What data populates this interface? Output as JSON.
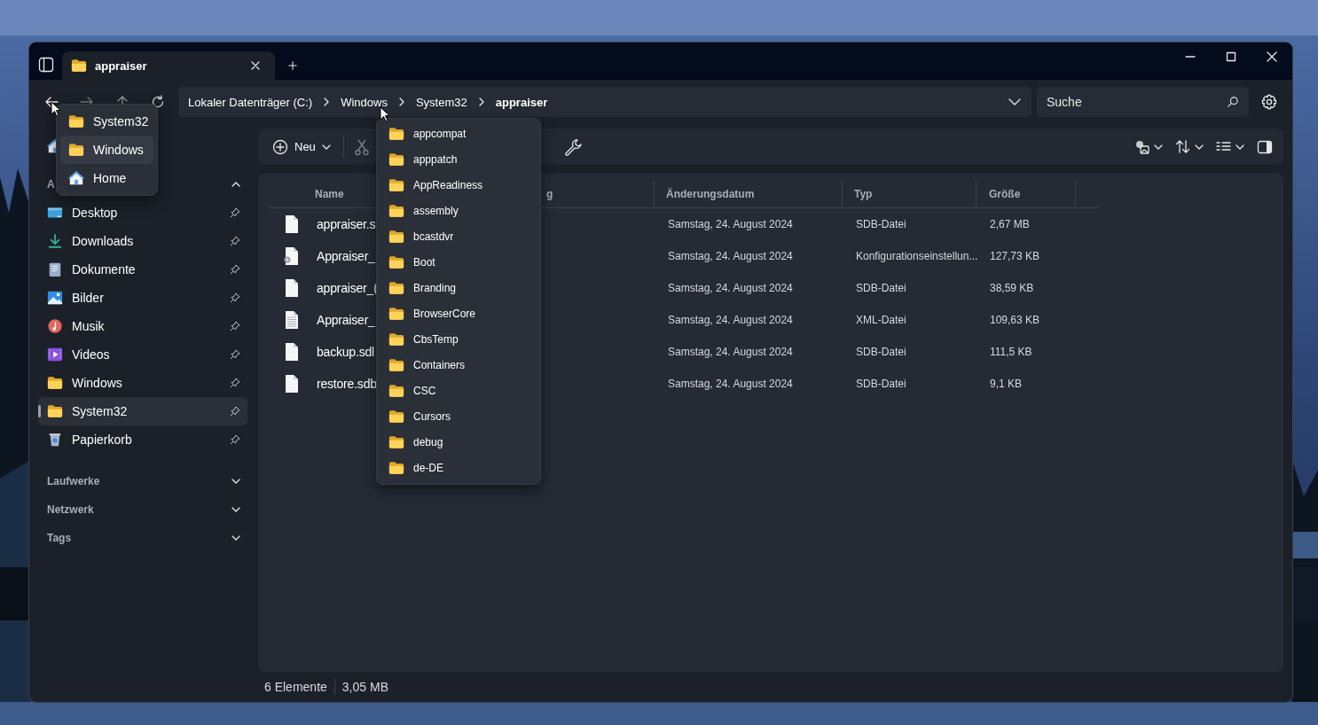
{
  "window": {
    "tab": {
      "title": "appraiser",
      "selected": true
    }
  },
  "address_bar": {
    "crumbs": [
      {
        "label": "Lokaler Datenträger (C:)",
        "current": false
      },
      {
        "label": "Windows",
        "current": false
      },
      {
        "label": "System32",
        "current": false
      },
      {
        "label": "appraiser",
        "current": true
      }
    ]
  },
  "search": {
    "placeholder": "Suche"
  },
  "history_menu": {
    "items": [
      {
        "label": "System32",
        "kind": "folder",
        "selected": false
      },
      {
        "label": "Windows",
        "kind": "folder",
        "selected": true
      },
      {
        "label": "Home",
        "kind": "home",
        "selected": false
      }
    ]
  },
  "folder_menu": {
    "items": [
      "appcompat",
      "apppatch",
      "AppReadiness",
      "assembly",
      "bcastdvr",
      "Boot",
      "Branding",
      "BrowserCore",
      "CbsTemp",
      "Containers",
      "CSC",
      "Cursors",
      "debug",
      "de-DE"
    ]
  },
  "toolbar": {
    "new_button": "Neu"
  },
  "sidebar": {
    "pinned_header": {
      "label": "A",
      "expanded": true
    },
    "items": [
      {
        "label": "Desktop",
        "kind": "desktop",
        "pinned": true,
        "selected": false
      },
      {
        "label": "Downloads",
        "kind": "download",
        "pinned": true,
        "selected": false
      },
      {
        "label": "Dokumente",
        "kind": "documents",
        "pinned": true,
        "selected": false
      },
      {
        "label": "Bilder",
        "kind": "pictures",
        "pinned": true,
        "selected": false
      },
      {
        "label": "Musik",
        "kind": "music",
        "pinned": true,
        "selected": false
      },
      {
        "label": "Videos",
        "kind": "videos",
        "pinned": true,
        "selected": false
      },
      {
        "label": "Windows",
        "kind": "folder",
        "pinned": true,
        "selected": false
      },
      {
        "label": "System32",
        "kind": "folder",
        "pinned": true,
        "selected": true
      },
      {
        "label": "Papierkorb",
        "kind": "recycle",
        "pinned": true,
        "selected": false
      }
    ],
    "sections": [
      {
        "label": "Laufwerke",
        "expanded": false
      },
      {
        "label": "Netzwerk",
        "expanded": false
      },
      {
        "label": "Tags",
        "expanded": false
      }
    ]
  },
  "table": {
    "columns": [
      "Name",
      "g",
      "Änderungsdatum",
      "Typ",
      "Größe"
    ],
    "rows": [
      {
        "kind": "file",
        "name": "appraiser.s",
        "date": "Samstag, 24. August 2024",
        "type": "SDB-Datei",
        "size": "2,67 MB"
      },
      {
        "kind": "config",
        "name": "Appraiser_",
        "date": "Samstag, 24. August 2024",
        "type": "Konfigurationseinstellun...",
        "size": "127,73 KB"
      },
      {
        "kind": "file",
        "name": "appraiser_(",
        "date": "Samstag, 24. August 2024",
        "type": "SDB-Datei",
        "size": "38,59 KB"
      },
      {
        "kind": "text",
        "name": "Appraiser_",
        "date": "Samstag, 24. August 2024",
        "type": "XML-Datei",
        "size": "109,63 KB"
      },
      {
        "kind": "file",
        "name": "backup.sdl",
        "date": "Samstag, 24. August 2024",
        "type": "SDB-Datei",
        "size": "111,5 KB"
      },
      {
        "kind": "file",
        "name": "restore.sdb",
        "date": "Samstag, 24. August 2024",
        "type": "SDB-Datei",
        "size": "9,1 KB"
      }
    ]
  },
  "status_bar": {
    "count": "6 Elemente",
    "size": "3,05 MB"
  }
}
